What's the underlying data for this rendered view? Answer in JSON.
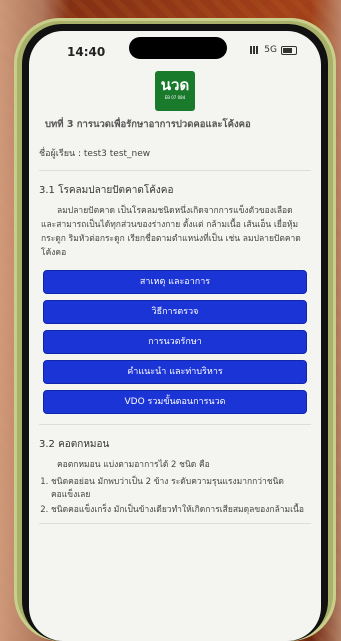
{
  "status": {
    "time": "14:40",
    "network": "5G"
  },
  "logo": {
    "text": "นวด",
    "subtext": "EB 07 084"
  },
  "page": {
    "chapter_title": "บทที่ 3 การนวดเพื่อรักษาอาการปวดคอและโค้งคอ",
    "learner": "ชื่อผู้เรียน : test3 test_new"
  },
  "section1": {
    "heading": "3.1 โรคลมปลายปัตคาดโค้งคอ",
    "paragraph": "ลมปลายปัตคาด เป็นโรคลมชนิดหนึ่งเกิดจากการแข็งตัวของเลือด และสามารถเป็นได้ทุกส่วนของร่างกาย ตั้งแต่ กล้ามเนื้อ เส้นเอ็น เยื่อหุ้มกระดูก ริมหัวต่อกระดูก เรียกชื่อตามตำแหน่งที่เป็น เช่น ลมปลายปัตคาดโค้งคอ",
    "buttons": [
      "สาเหตุ และอาการ",
      "วิธีการตรวจ",
      "การนวดรักษา",
      "คำแนะนำ และท่าบริหาร",
      "VDO รวมขั้นตอนการนวด"
    ]
  },
  "section2": {
    "heading": "3.2 คอตกหมอน",
    "intro": "คอตกหมอน แบ่งตามอาการได้ 2 ชนิด คือ",
    "items": [
      "ชนิดคอย่อน มักพบว่าเป็น 2 ข้าง ระดับความรุนแรงมากกว่าชนิดคอแข็งเลย",
      "ชนิดคอแข็งเกร็ง มักเป็นข้างเดียวทำให้เกิดการเสียสมดุลของกล้ามเนื้อ"
    ]
  }
}
